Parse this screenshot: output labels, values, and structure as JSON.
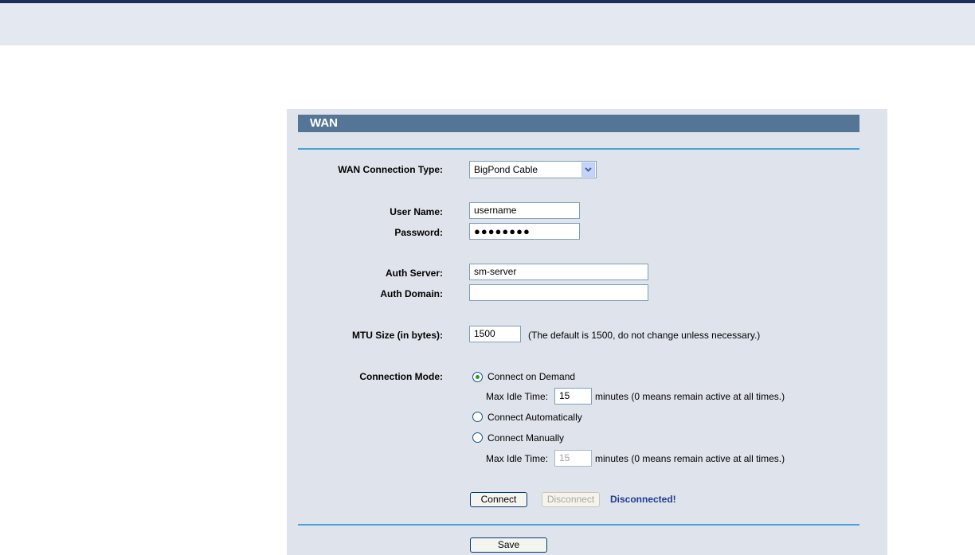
{
  "section": {
    "title": "WAN"
  },
  "wan_type": {
    "label": "WAN Connection Type:",
    "value": "BigPond Cable"
  },
  "username": {
    "label": "User Name:",
    "value": "username"
  },
  "password": {
    "label": "Password:",
    "value": "●●●●●●●●"
  },
  "auth_server": {
    "label": "Auth Server:",
    "value": "sm-server"
  },
  "auth_domain": {
    "label": "Auth Domain:",
    "value": ""
  },
  "mtu": {
    "label": "MTU Size (in bytes):",
    "value": "1500",
    "hint": "(The default is 1500, do not change unless necessary.)"
  },
  "connection_mode": {
    "label": "Connection Mode:",
    "selected": "on_demand",
    "on_demand": {
      "label": "Connect on Demand",
      "idle_label": "Max Idle Time:",
      "idle_value": "15",
      "idle_hint": "minutes (0 means remain active at all times.)"
    },
    "automatic": {
      "label": "Connect Automatically"
    },
    "manual": {
      "label": "Connect Manually",
      "idle_label": "Max Idle Time:",
      "idle_value": "15",
      "idle_hint": "minutes (0 means remain active at all times.)"
    }
  },
  "actions": {
    "connect": "Connect",
    "disconnect": "Disconnect",
    "status": "Disconnected!"
  },
  "save": "Save",
  "colors": {
    "title_bar": "#557597",
    "panel": "#dfe4ec",
    "rule": "#4aa3d8",
    "status": "#1f3a8f"
  }
}
